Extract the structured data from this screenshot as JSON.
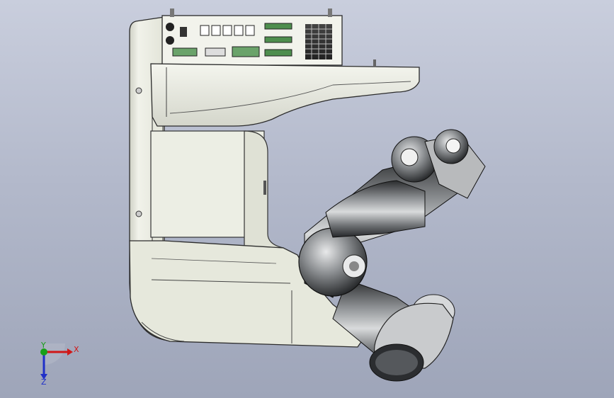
{
  "scene": {
    "background_top": "#c9cedd",
    "background_bottom": "#9ea5b9",
    "body_color": "#e9ebe0",
    "arm_dark": "#3a3d40",
    "arm_light": "#c8cacc"
  },
  "connector_panel": {
    "port_labels": [
      "",
      "",
      "",
      "",
      "",
      "",
      "",
      "",
      "",
      ""
    ]
  },
  "triad": {
    "x_label": "X",
    "y_label": "Y",
    "z_label": "Z",
    "x_color": "#d01818",
    "y_color": "#18a018",
    "z_color": "#2030c8"
  }
}
